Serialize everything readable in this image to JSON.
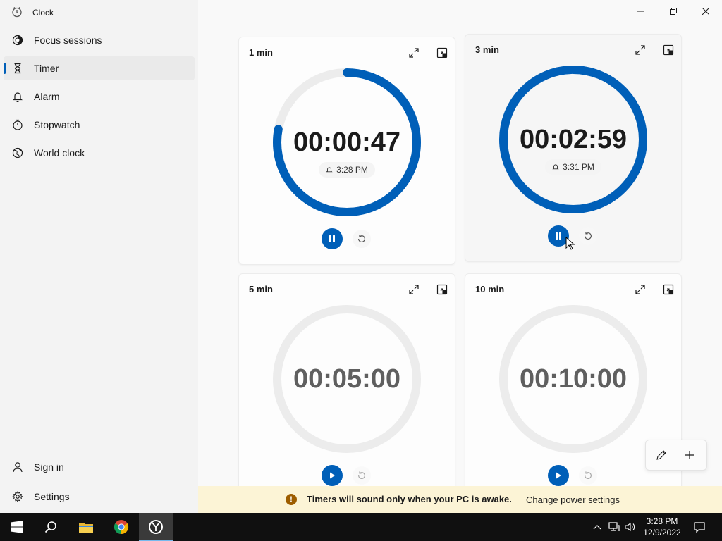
{
  "app": {
    "title": "Clock",
    "accent": "#005fb8"
  },
  "sidebar": {
    "items": [
      {
        "label": "Focus sessions",
        "icon": "focus-icon"
      },
      {
        "label": "Timer",
        "icon": "hourglass-icon",
        "active": true
      },
      {
        "label": "Alarm",
        "icon": "bell-icon"
      },
      {
        "label": "Stopwatch",
        "icon": "stopwatch-icon"
      },
      {
        "label": "World clock",
        "icon": "globe-icon"
      }
    ],
    "sign_in": "Sign in",
    "settings": "Settings"
  },
  "timers": [
    {
      "title": "1 min",
      "time": "00:00:47",
      "alarm": "3:28 PM",
      "state": "running",
      "progress": 0.78
    },
    {
      "title": "3 min",
      "time": "00:02:59",
      "alarm": "3:31 PM",
      "state": "running",
      "progress": 0.995
    },
    {
      "title": "5 min",
      "time": "00:05:00",
      "state": "stopped",
      "progress": 0
    },
    {
      "title": "10 min",
      "time": "00:10:00",
      "state": "stopped",
      "progress": 0
    }
  ],
  "banner": {
    "message": "Timers will sound only when your PC is awake.",
    "link": "Change power settings"
  },
  "taskbar": {
    "time": "3:28 PM",
    "date": "12/9/2022"
  }
}
